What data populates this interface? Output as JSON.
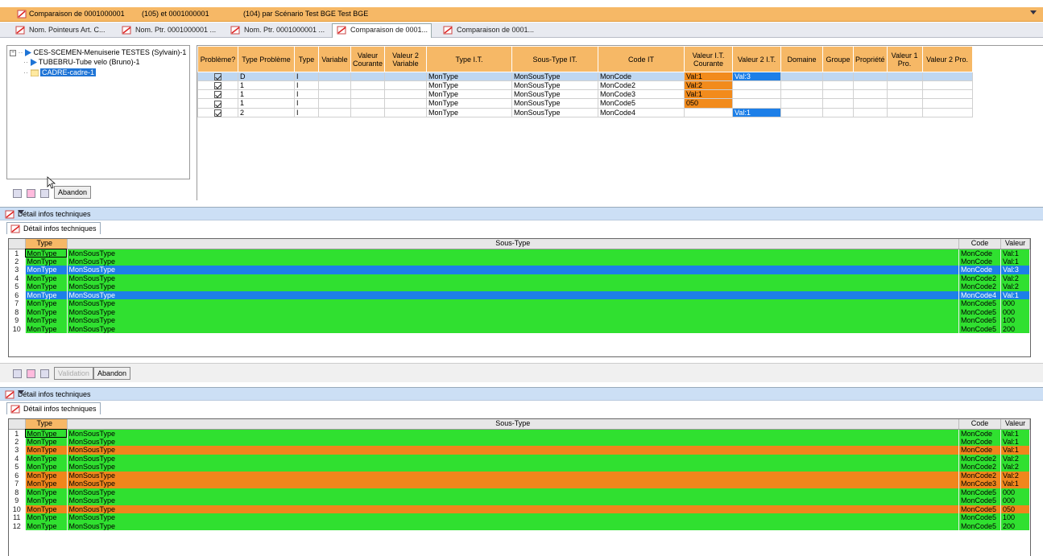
{
  "window": {
    "title_part1": "Comparaison de 0001000001",
    "title_part2": "(105) et 0001000001",
    "title_part3": "(104) par Scénario Test BGE Test BGE"
  },
  "tabs": [
    {
      "label": "Nom. Pointeurs Art. C..."
    },
    {
      "label": "Nom. Ptr. 0001000001 ..."
    },
    {
      "label": "Nom. Ptr. 0001000001 ..."
    },
    {
      "label": "Comparaison de 0001..."
    },
    {
      "label": "Comparaison de 0001..."
    }
  ],
  "tree": {
    "root": "CES-SCEMEN-Menuiserie TESTES (Sylvain)-1",
    "child1": "TUBEBRU-Tube velo (Bruno)-1",
    "child2": "CADRE-cadre-1"
  },
  "top_buttons": {
    "abandon": "Abandon"
  },
  "compare_grid": {
    "headers": [
      "Problème?",
      "Type Problème",
      "Type",
      "Variable",
      "Valeur Courante",
      "Valeur 2 Variable",
      "Type I.T.",
      "Sous-Type IT.",
      "Code IT",
      "Valeur I.T. Courante",
      "Valeur 2 I.T.",
      "Domaine",
      "Groupe",
      "Propriété",
      "Valeur 1 Pro.",
      "Valeur 2 Pro."
    ],
    "rows": [
      {
        "type_probleme": "D",
        "type": "I",
        "type_it": "MonType",
        "sous_type": "MonSousType",
        "code": "MonCode",
        "val_cour": "Val:1",
        "val2": "Val:3"
      },
      {
        "type_probleme": "1",
        "type": "I",
        "type_it": "MonType",
        "sous_type": "MonSousType",
        "code": "MonCode2",
        "val_cour": "Val:2",
        "val2": ""
      },
      {
        "type_probleme": "1",
        "type": "I",
        "type_it": "MonType",
        "sous_type": "MonSousType",
        "code": "MonCode3",
        "val_cour": "Val:1",
        "val2": ""
      },
      {
        "type_probleme": "1",
        "type": "I",
        "type_it": "MonType",
        "sous_type": "MonSousType",
        "code": "MonCode5",
        "val_cour": "050",
        "val2": ""
      },
      {
        "type_probleme": "2",
        "type": "I",
        "type_it": "MonType",
        "sous_type": "MonSousType",
        "code": "MonCode4",
        "val_cour": "",
        "val2": "Val:1"
      }
    ]
  },
  "section1": {
    "header": "Détail infos techniques",
    "tab": "Détail infos techniques",
    "columns": [
      "Type",
      "Sous-Type",
      "Code",
      "Valeur"
    ],
    "rows": [
      {
        "n": "1",
        "type": "MonType",
        "sub": "MonSousType",
        "code": "MonCode",
        "val": "Val:1",
        "color": "green"
      },
      {
        "n": "2",
        "type": "MonType",
        "sub": "MonSousType",
        "code": "MonCode",
        "val": "Val:1",
        "color": "green"
      },
      {
        "n": "3",
        "type": "MonType",
        "sub": "MonSousType",
        "code": "MonCode",
        "val": "Val:3",
        "color": "blue"
      },
      {
        "n": "4",
        "type": "MonType",
        "sub": "MonSousType",
        "code": "MonCode2",
        "val": "Val:2",
        "color": "green"
      },
      {
        "n": "5",
        "type": "MonType",
        "sub": "MonSousType",
        "code": "MonCode2",
        "val": "Val:2",
        "color": "green"
      },
      {
        "n": "6",
        "type": "MonType",
        "sub": "MonSousType",
        "code": "MonCode4",
        "val": "Val:1",
        "color": "blue"
      },
      {
        "n": "7",
        "type": "MonType",
        "sub": "MonSousType",
        "code": "MonCode5",
        "val": "000",
        "color": "green"
      },
      {
        "n": "8",
        "type": "MonType",
        "sub": "MonSousType",
        "code": "MonCode5",
        "val": "000",
        "color": "green"
      },
      {
        "n": "9",
        "type": "MonType",
        "sub": "MonSousType",
        "code": "MonCode5",
        "val": "100",
        "color": "green"
      },
      {
        "n": "10",
        "type": "MonType",
        "sub": "MonSousType",
        "code": "MonCode5",
        "val": "200",
        "color": "green"
      }
    ]
  },
  "mid_buttons": {
    "validation": "Validation",
    "abandon": "Abandon"
  },
  "section2": {
    "header": "Détail infos techniques",
    "tab": "Détail infos techniques",
    "columns": [
      "Type",
      "Sous-Type",
      "Code",
      "Valeur"
    ],
    "rows": [
      {
        "n": "1",
        "type": "MonType",
        "sub": "MonSousType",
        "code": "MonCode",
        "val": "Val:1",
        "color": "green"
      },
      {
        "n": "2",
        "type": "MonType",
        "sub": "MonSousType",
        "code": "MonCode",
        "val": "Val:1",
        "color": "green"
      },
      {
        "n": "3",
        "type": "MonType",
        "sub": "MonSousType",
        "code": "MonCode",
        "val": "Val:1",
        "color": "orange"
      },
      {
        "n": "4",
        "type": "MonType",
        "sub": "MonSousType",
        "code": "MonCode2",
        "val": "Val:2",
        "color": "green"
      },
      {
        "n": "5",
        "type": "MonType",
        "sub": "MonSousType",
        "code": "MonCode2",
        "val": "Val:2",
        "color": "green"
      },
      {
        "n": "6",
        "type": "MonType",
        "sub": "MonSousType",
        "code": "MonCode2",
        "val": "Val:2",
        "color": "orange"
      },
      {
        "n": "7",
        "type": "MonType",
        "sub": "MonSousType",
        "code": "MonCode3",
        "val": "Val:1",
        "color": "orange"
      },
      {
        "n": "8",
        "type": "MonType",
        "sub": "MonSousType",
        "code": "MonCode5",
        "val": "000",
        "color": "green"
      },
      {
        "n": "9",
        "type": "MonType",
        "sub": "MonSousType",
        "code": "MonCode5",
        "val": "000",
        "color": "green"
      },
      {
        "n": "10",
        "type": "MonType",
        "sub": "MonSousType",
        "code": "MonCode5",
        "val": "050",
        "color": "orange"
      },
      {
        "n": "11",
        "type": "MonType",
        "sub": "MonSousType",
        "code": "MonCode5",
        "val": "100",
        "color": "green"
      },
      {
        "n": "12",
        "type": "MonType",
        "sub": "MonSousType",
        "code": "MonCode5",
        "val": "200",
        "color": "green"
      }
    ]
  }
}
